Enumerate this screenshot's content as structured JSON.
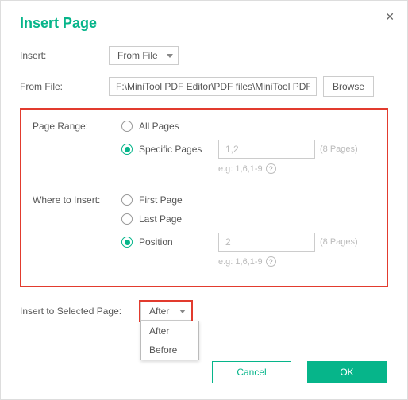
{
  "dialog": {
    "title": "Insert Page",
    "labels": {
      "insert": "Insert:",
      "from_file": "From File:",
      "page_range": "Page Range:",
      "where": "Where to Insert:",
      "insert_to_selected": "Insert to Selected Page:"
    }
  },
  "insert_source": {
    "selected": "From File"
  },
  "file": {
    "path": "F:\\MiniTool PDF Editor\\PDF files\\MiniTool PDF",
    "browse": "Browse"
  },
  "page_range": {
    "options": {
      "all": "All Pages",
      "specific": "Specific Pages"
    },
    "selected": "specific",
    "specific_value": "",
    "specific_placeholder": "1,2",
    "count_hint": "(8 Pages)",
    "example": "e.g: 1,6,1-9"
  },
  "where": {
    "options": {
      "first": "First Page",
      "last": "Last Page",
      "position": "Position"
    },
    "selected": "position",
    "position_value": "",
    "position_placeholder": "2",
    "count_hint": "(8 Pages)",
    "example": "e.g: 1,6,1-9"
  },
  "relative": {
    "selected": "After",
    "options": [
      "After",
      "Before"
    ]
  },
  "buttons": {
    "cancel": "Cancel",
    "ok": "OK"
  }
}
